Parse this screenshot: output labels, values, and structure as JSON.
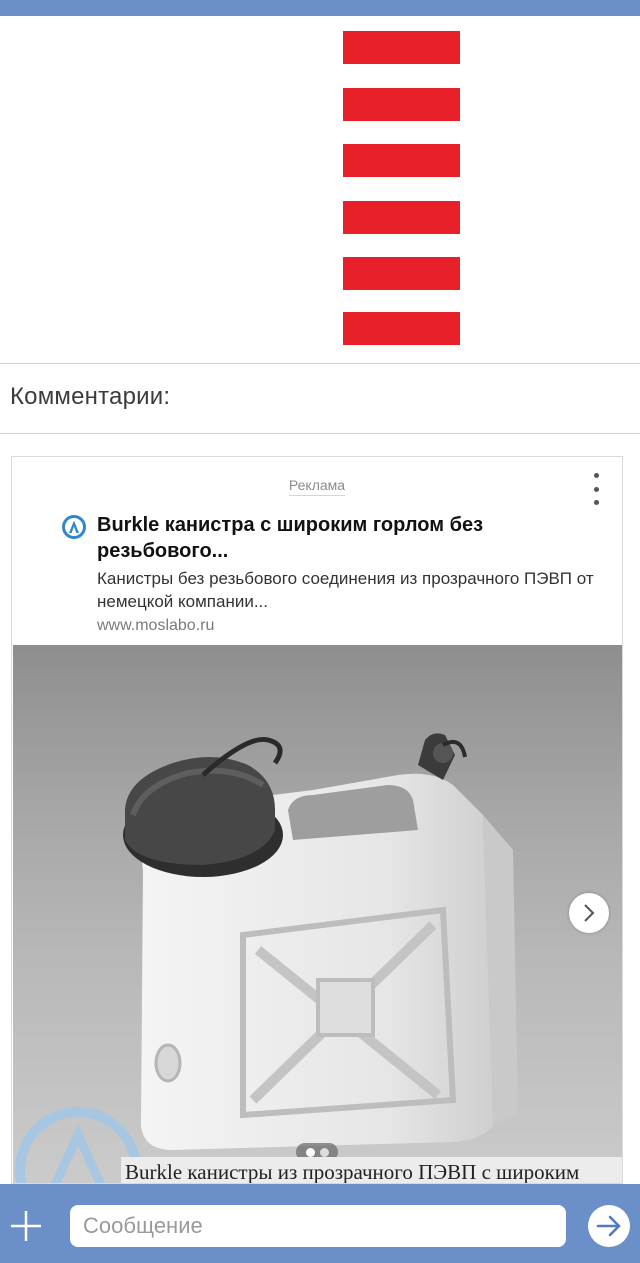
{
  "post": {
    "image_icon": "hamburger-menu-icon",
    "stripe_color": "#e8202a"
  },
  "comments": {
    "title": "Комментарии:"
  },
  "ad": {
    "label": "Реклама",
    "title": "Burkle канистра с широким горлом без резьбового...",
    "description": "Канистры без резьбового соединения из прозрачного ПЭВП от немецкой компании...",
    "domain": "www.moslabo.ru",
    "photo_caption": "Burkle канистры из прозрачного ПЭВП с широким",
    "carousel": {
      "count": 2,
      "active": 0
    }
  },
  "composer": {
    "placeholder": "Сообщение",
    "accent_color": "#6a8fc9"
  }
}
